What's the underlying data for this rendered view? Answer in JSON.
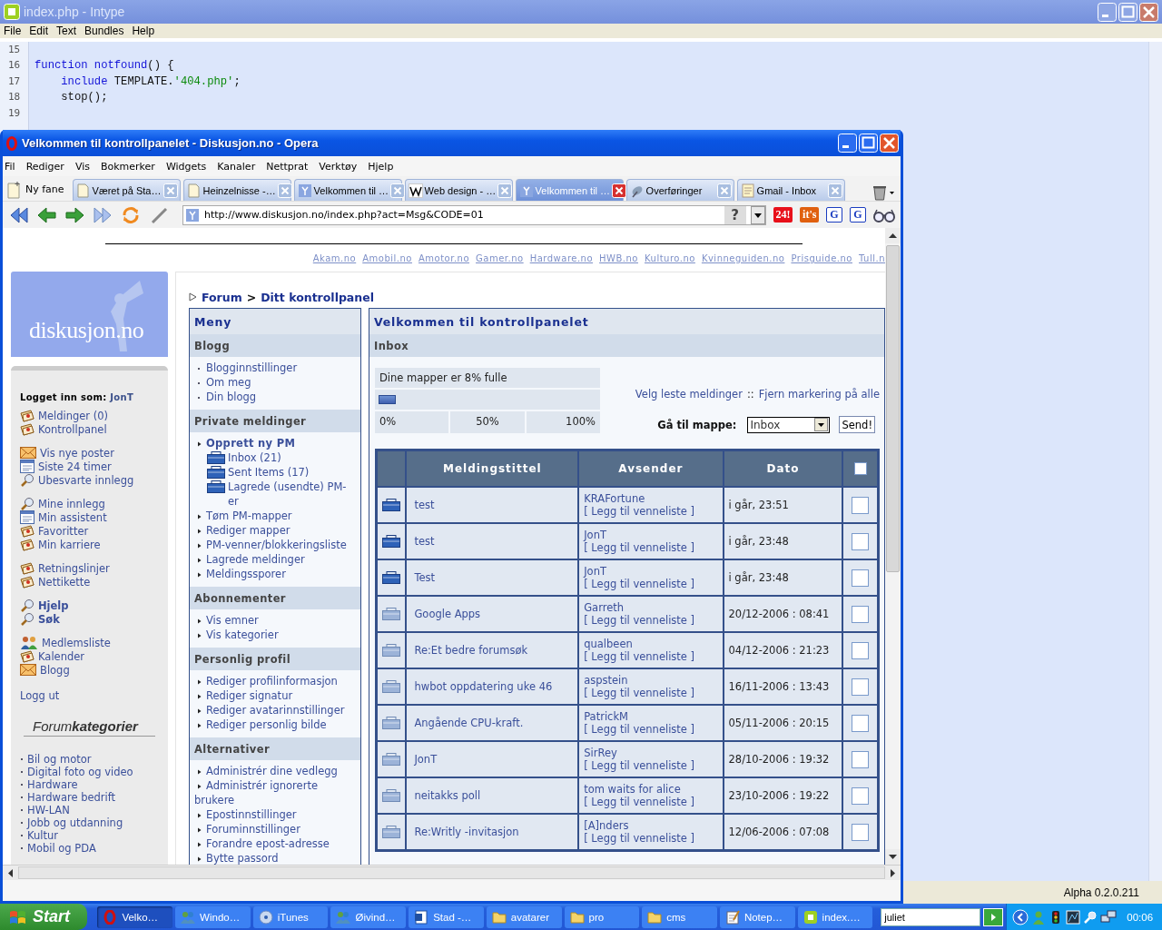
{
  "editor": {
    "title": "index.php - Intype",
    "menu": [
      "File",
      "Edit",
      "Text",
      "Bundles",
      "Help"
    ],
    "lines": [
      {
        "number": "15"
      },
      {
        "number": "16",
        "tokens": [
          {
            "text": "function ",
            "kind": "keyword"
          },
          {
            "text": "notfound",
            "kind": "keyword"
          },
          {
            "text": "() {",
            "kind": "plain"
          }
        ]
      },
      {
        "number": "17",
        "tokens": [
          {
            "text": "    include",
            "kind": "keyword"
          },
          {
            "text": " TEMPLATE.",
            "kind": "plain"
          },
          {
            "text": "'404.php'",
            "kind": "string"
          },
          {
            "text": ";",
            "kind": "plain"
          }
        ]
      },
      {
        "number": "18",
        "tokens": [
          {
            "text": "    stop();",
            "kind": "plain"
          }
        ]
      },
      {
        "number": "19"
      }
    ],
    "status": "Alpha 0.2.0.211"
  },
  "browser": {
    "title": "Velkommen til kontrollpanelet - Diskusjon.no - Opera",
    "menu": [
      "Fil",
      "Rediger",
      "Vis",
      "Bokmerker",
      "Widgets",
      "Kanaler",
      "Nettprat",
      "Verktøy",
      "Hjelp"
    ],
    "new_tab": "Ny fane",
    "tabs": [
      {
        "label": "Været på Sta…",
        "kind": "page",
        "selected": false
      },
      {
        "label": "Heinzelnisse -…",
        "kind": "page",
        "selected": false
      },
      {
        "label": "Velkommen til …",
        "kind": "site",
        "selected": false
      },
      {
        "label": "Web design - …",
        "kind": "wiki",
        "selected": false
      },
      {
        "label": "Velkommen til …",
        "kind": "site",
        "selected": true
      },
      {
        "label": "Overføringer",
        "kind": "transfer",
        "selected": false
      },
      {
        "label": "Gmail - Inbox",
        "kind": "notes",
        "selected": false
      }
    ],
    "address": "http://www.diskusjon.no/index.php?act=Msg&CODE=01",
    "address_help": "?",
    "badges": [
      {
        "label": "24!",
        "color": "#e8101a"
      },
      {
        "label": "it's",
        "color": "#e0600f"
      },
      {
        "label": "G",
        "color": "#1a3cc0"
      },
      {
        "label": "G",
        "color": "#1a3cc0"
      }
    ]
  },
  "page": {
    "site_links": [
      "Akam.no",
      "Amobil.no",
      "Amotor.no",
      "Gamer.no",
      "Hardware.no",
      "HWB.no",
      "Kulturo.no",
      "Kvinneguiden.no",
      "Prisguide.no",
      "Tull.n"
    ],
    "logo": "diskusjon.no",
    "user_label": "Logget inn som:",
    "user_name": "JonT",
    "nav_groups": [
      {
        "bold": false,
        "items": [
          {
            "label": "Meldinger (0)",
            "kind": "note"
          },
          {
            "label": "Kontrollpanel",
            "kind": "note"
          }
        ]
      },
      {
        "bold": false,
        "items": [
          {
            "label": "Vis nye poster",
            "kind": "mail"
          },
          {
            "label": "Siste 24 timer",
            "kind": "calendar"
          },
          {
            "label": "Ubesvarte innlegg",
            "kind": "search"
          }
        ]
      },
      {
        "bold": false,
        "items": [
          {
            "label": "Mine innlegg",
            "kind": "search"
          },
          {
            "label": "Min assistent",
            "kind": "calendar"
          },
          {
            "label": "Favoritter",
            "kind": "note"
          },
          {
            "label": "Min karriere",
            "kind": "note"
          }
        ]
      },
      {
        "bold": false,
        "items": [
          {
            "label": "Retningslinjer",
            "kind": "note"
          },
          {
            "label": "Nettikette",
            "kind": "note"
          }
        ]
      },
      {
        "bold": true,
        "items": [
          {
            "label": "Hjelp",
            "kind": "search"
          },
          {
            "label": "Søk",
            "kind": "search"
          }
        ]
      },
      {
        "bold": false,
        "items": [
          {
            "label": "Medlemsliste",
            "kind": "people"
          },
          {
            "label": "Kalender",
            "kind": "note"
          },
          {
            "label": "Blogg",
            "kind": "mail"
          }
        ]
      }
    ],
    "logout": "Logg ut",
    "categories_title": "Forum**kategorier**",
    "categories": [
      "Bil og motor",
      "Digital foto og video",
      "Hardware",
      "Hardware bedrift",
      "HW-LAN",
      "Jobb og utdanning",
      "Kultur",
      "Mobil og PDA"
    ],
    "breadcrumb": [
      {
        "label": "Forum",
        "kind": "link"
      },
      {
        "label": ">",
        "kind": "separator"
      },
      {
        "label": "Ditt kontrollpanel",
        "kind": "link"
      }
    ],
    "menu": {
      "title": "Meny",
      "sections": [
        {
          "title": "Blogg",
          "items": [
            {
              "label": "Blogginnstillinger",
              "kind": "dot"
            },
            {
              "label": "Om meg",
              "kind": "dot"
            },
            {
              "label": "Din blogg",
              "kind": "dot"
            }
          ]
        },
        {
          "title": "Private meldinger",
          "items": [
            {
              "label": "Opprett ny PM",
              "kind": "main",
              "children": [
                {
                  "label": "Inbox (21)",
                  "kind": "folder"
                },
                {
                  "label": "Sent Items (17)",
                  "kind": "folder"
                },
                {
                  "label": "Lagrede (usendte) PM-er",
                  "kind": "folder"
                }
              ]
            },
            {
              "label": "Tøm PM-mapper",
              "kind": "arrow"
            },
            {
              "label": "Rediger mapper",
              "kind": "arrow"
            },
            {
              "label": "PM-venner/blokkeringsliste",
              "kind": "arrow"
            },
            {
              "label": "Lagrede meldinger",
              "kind": "arrow"
            },
            {
              "label": "Meldingssporer",
              "kind": "arrow"
            }
          ]
        },
        {
          "title": "Abonnementer",
          "items": [
            {
              "label": "Vis emner",
              "kind": "arrow"
            },
            {
              "label": "Vis kategorier",
              "kind": "arrow"
            }
          ]
        },
        {
          "title": "Personlig profil",
          "items": [
            {
              "label": "Rediger profilinformasjon",
              "kind": "arrow"
            },
            {
              "label": "Rediger signatur",
              "kind": "arrow"
            },
            {
              "label": "Rediger avatarinnstillinger",
              "kind": "arrow"
            },
            {
              "label": "Rediger personlig bilde",
              "kind": "arrow"
            }
          ]
        },
        {
          "title": "Alternativer",
          "items": [
            {
              "label": "Administrér dine vedlegg",
              "kind": "arrow"
            },
            {
              "label": "Administrér ignorerte brukere",
              "kind": "arrow"
            },
            {
              "label": "Epostinnstillinger",
              "kind": "arrow"
            },
            {
              "label": "Foruminnstillinger",
              "kind": "arrow"
            },
            {
              "label": "Forandre epost-adresse",
              "kind": "arrow"
            },
            {
              "label": "Bytte passord",
              "kind": "arrow"
            }
          ]
        }
      ]
    },
    "inbox": {
      "title": "Velkommen til kontrollpanelet",
      "subtitle": "Inbox",
      "usage": {
        "label": "Dine mapper er 8% fulle",
        "level": 0.08,
        "ticks": [
          "0%",
          "50%",
          "100%"
        ]
      },
      "actions": [
        {
          "label": "Velg leste meldinger",
          "kind": "link"
        },
        {
          "label": "::",
          "kind": "separator"
        },
        {
          "label": "Fjern markering på alle",
          "kind": "link"
        }
      ],
      "folder_label": "Gå til mappe:",
      "folder_value": "Inbox",
      "submit": "Send!",
      "columns": [
        "Meldingstittel",
        "Avsender",
        "Dato"
      ],
      "select_all_checked": false,
      "rows": [
        {
          "title": "test",
          "sender": "KRAFortune",
          "friend": "[ Legg til venneliste ]",
          "date": "i går, 23:51",
          "read": false,
          "checked": false
        },
        {
          "title": "test",
          "sender": "JonT",
          "friend": "[ Legg til venneliste ]",
          "date": "i går, 23:48",
          "read": false,
          "checked": false
        },
        {
          "title": "Test",
          "sender": "JonT",
          "friend": "[ Legg til venneliste ]",
          "date": "i går, 23:48",
          "read": false,
          "checked": false
        },
        {
          "title": "Google Apps",
          "sender": "Garreth",
          "friend": "[ Legg til venneliste ]",
          "date": "20/12-2006 : 08:41",
          "read": true,
          "checked": false
        },
        {
          "title": "Re:Et bedre forumsøk",
          "sender": "qualbeen",
          "friend": "[ Legg til venneliste ]",
          "date": "04/12-2006 : 21:23",
          "read": true,
          "checked": false
        },
        {
          "title": "hwbot oppdatering uke 46",
          "sender": "aspstein",
          "friend": "[ Legg til venneliste ]",
          "date": "16/11-2006 : 13:43",
          "read": true,
          "checked": false
        },
        {
          "title": "Angående CPU-kraft.",
          "sender": "PatrickM",
          "friend": "[ Legg til venneliste ]",
          "date": "05/11-2006 : 20:15",
          "read": true,
          "checked": false
        },
        {
          "title": "JonT",
          "sender": "SirRey",
          "friend": "[ Legg til venneliste ]",
          "date": "28/10-2006 : 19:32",
          "read": true,
          "checked": false
        },
        {
          "title": "neitakks poll",
          "sender": "tom waits for alice",
          "friend": "[ Legg til venneliste ]",
          "date": "23/10-2006 : 19:22",
          "read": true,
          "checked": false
        },
        {
          "title": "Re:Writly -invitasjon",
          "sender": "[A]nders",
          "friend": "[ Legg til venneliste ]",
          "date": "12/06-2006 : 07:08",
          "read": true,
          "checked": false
        }
      ]
    }
  },
  "taskbar": {
    "start": "Start",
    "buttons": [
      {
        "label": "Velko…",
        "kind": "opera",
        "selected": true
      },
      {
        "label": "Windo…",
        "kind": "people",
        "selected": false
      },
      {
        "label": "iTunes",
        "kind": "music",
        "selected": false
      },
      {
        "label": "Øivind…",
        "kind": "people",
        "selected": false
      },
      {
        "label": "Stad -…",
        "kind": "doc",
        "selected": false
      },
      {
        "label": "avatarer",
        "kind": "folder",
        "selected": false
      },
      {
        "label": "pro",
        "kind": "folder",
        "selected": false
      },
      {
        "label": "cms",
        "kind": "folder",
        "selected": false
      },
      {
        "label": "Notep…",
        "kind": "notepad",
        "selected": false
      },
      {
        "label": "index.…",
        "kind": "intype",
        "selected": false
      }
    ],
    "search_value": "juliet",
    "clock": "00:06"
  }
}
